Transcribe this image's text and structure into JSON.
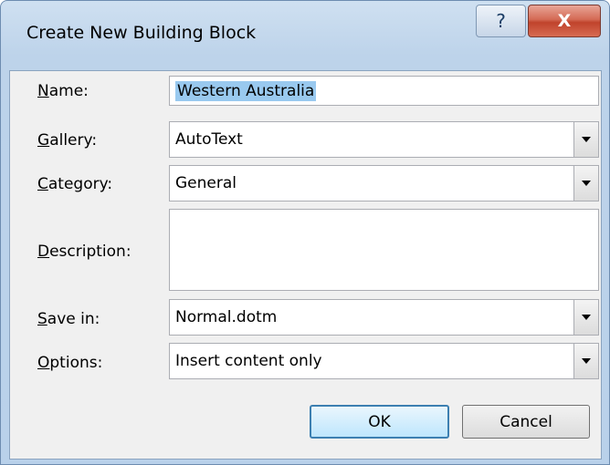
{
  "window": {
    "title": "Create New Building Block",
    "help_glyph": "?",
    "close_glyph": "X"
  },
  "form": {
    "name": {
      "label_accel": "N",
      "label_rest": "ame:",
      "value": "Western Australia"
    },
    "gallery": {
      "label_accel": "G",
      "label_rest": "allery:",
      "value": "AutoText"
    },
    "category": {
      "label_accel": "C",
      "label_rest": "ategory:",
      "value": "General"
    },
    "description": {
      "label_accel": "D",
      "label_rest": "escription:",
      "value": ""
    },
    "save_in": {
      "label_accel": "S",
      "label_rest": "ave in:",
      "value": "Normal.dotm"
    },
    "options": {
      "label_accel": "O",
      "label_rest": "ptions:",
      "value": "Insert content only"
    }
  },
  "buttons": {
    "ok": "OK",
    "cancel": "Cancel"
  },
  "icons": {
    "help": "help-icon",
    "close": "close-icon",
    "dropdown": "chevron-down-icon"
  },
  "colors": {
    "title_bar": "#bdd3ea",
    "close_button": "#c0432c",
    "selection": "#99c9ef",
    "default_button_border": "#3c7fb1"
  }
}
